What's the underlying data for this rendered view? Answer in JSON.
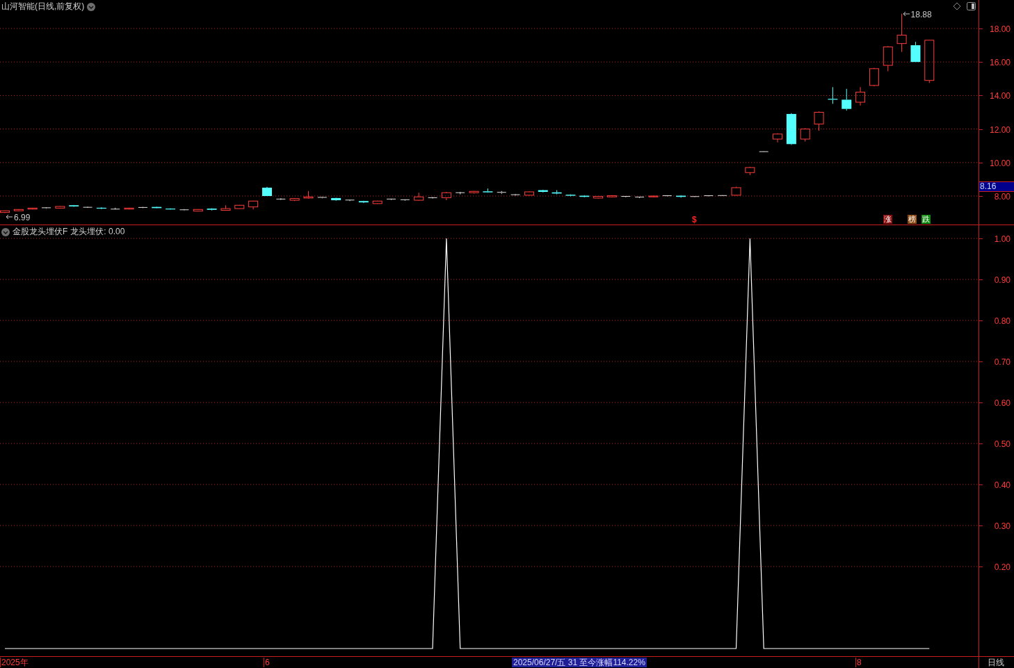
{
  "header": {
    "title": "山河智能(日线,前复权)"
  },
  "price_panel": {
    "y_axis": [
      "18.00",
      "16.00",
      "14.00",
      "12.00",
      "10.00",
      "8.00"
    ],
    "price_labels": [
      "18.88",
      "6.99"
    ],
    "signals": [
      {
        "text": "$",
        "color": "#ff2020"
      }
    ],
    "badges": [
      {
        "text": "涨",
        "color": "#8b0a0a"
      },
      {
        "text": "榜",
        "color": "#8b4a14"
      },
      {
        "text": "跌",
        "color": "#108a10"
      }
    ],
    "price_tag": "8.16"
  },
  "indicator_panel": {
    "title": "金股龙头埋伏F",
    "readout": "龙头埋伏: 0.00",
    "chart_data": {
      "type": "line",
      "ylim": [
        -0.0186,
        1
      ],
      "grid": true,
      "yticks": [
        {
          "value": 0.2,
          "label": "0.20"
        },
        {
          "value": 0.3,
          "label": "0.30"
        },
        {
          "value": 0.4,
          "label": "0.40"
        },
        {
          "value": 0.5,
          "label": "0.50"
        },
        {
          "value": 0.6,
          "label": "0.60"
        },
        {
          "value": 0.7,
          "label": "0.70"
        },
        {
          "value": 0.8,
          "label": "0.80"
        },
        {
          "value": 0.9,
          "label": "0.90"
        },
        {
          "value": 1.0,
          "label": "1.00"
        }
      ],
      "series": [
        {
          "color": "#ffffff",
          "values": [
            0,
            0,
            0,
            0,
            0,
            0,
            0,
            0,
            0,
            0,
            0,
            0,
            0,
            0,
            0,
            0,
            0,
            0,
            0,
            0,
            0,
            0,
            0,
            0,
            0,
            0,
            0,
            0,
            0,
            0,
            0,
            0,
            1,
            0,
            0,
            0,
            0,
            0,
            0,
            0,
            0,
            0,
            0,
            0,
            0,
            0,
            0,
            0,
            0,
            0,
            0,
            0,
            0,
            0,
            1,
            0,
            0,
            0,
            0,
            0,
            0,
            0,
            0,
            0,
            0,
            0,
            0,
            0
          ]
        }
      ]
    }
  },
  "footer": {
    "labels": [
      "2025年",
      "6",
      "8"
    ],
    "info": "2025/06/27/五 31 至今涨幅114.22%",
    "period": "日线"
  }
}
